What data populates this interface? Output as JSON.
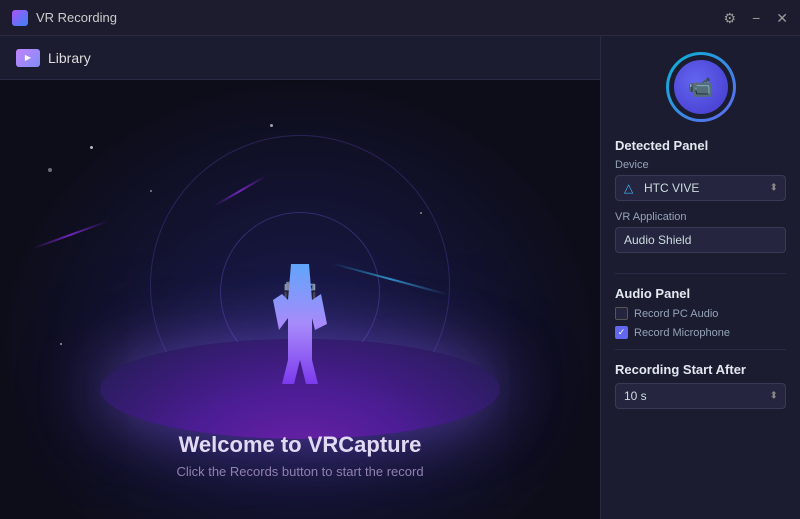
{
  "titleBar": {
    "title": "VR Recording",
    "settingsIcon": "⚙",
    "minimizeIcon": "−",
    "closeIcon": "✕"
  },
  "nav": {
    "libraryLabel": "Library"
  },
  "welcome": {
    "title": "Welcome to VRCapture",
    "subtitle": "Click the Records button to start the record"
  },
  "rightPanel": {
    "detectedPanelTitle": "Detected Panel",
    "deviceLabel": "Device",
    "deviceName": "HTC VIVE",
    "vrApplicationLabel": "VR Application",
    "vrApplicationValue": "Audio Shield",
    "audioPanelTitle": "Audio Panel",
    "recordPcAudioLabel": "Record PC Audio",
    "recordPcAudioChecked": false,
    "recordMicrophoneLabel": "Record Microphone",
    "recordMicrophoneChecked": true,
    "recordingStartAfterTitle": "Recording Start After",
    "recordingStartAfterValue": "10 s"
  }
}
